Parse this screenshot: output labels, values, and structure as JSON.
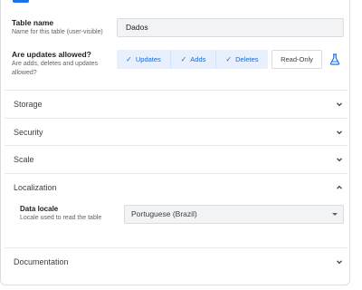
{
  "table_name": {
    "label": "Table name",
    "help": "Name for this table (user-visible)",
    "value": "Dados"
  },
  "updates": {
    "label": "Are updates allowed?",
    "help": "Are adds, deletes and updates allowed?",
    "options": [
      {
        "label": "Updates",
        "selected": true
      },
      {
        "label": "Adds",
        "selected": true
      },
      {
        "label": "Deletes",
        "selected": true
      },
      {
        "label": "Read-Only",
        "selected": false
      }
    ],
    "flask_icon": "flask-icon"
  },
  "sections": {
    "storage": "Storage",
    "security": "Security",
    "scale": "Scale",
    "localization": "Localization",
    "documentation": "Documentation"
  },
  "localization": {
    "data_locale_label": "Data locale",
    "data_locale_help": "Locale used to read the table",
    "data_locale_value": "Portuguese (Brazil)"
  },
  "colors": {
    "accent": "#1a73e8",
    "selected_bg": "#e8f0fe",
    "selected_text": "#1967d2"
  }
}
